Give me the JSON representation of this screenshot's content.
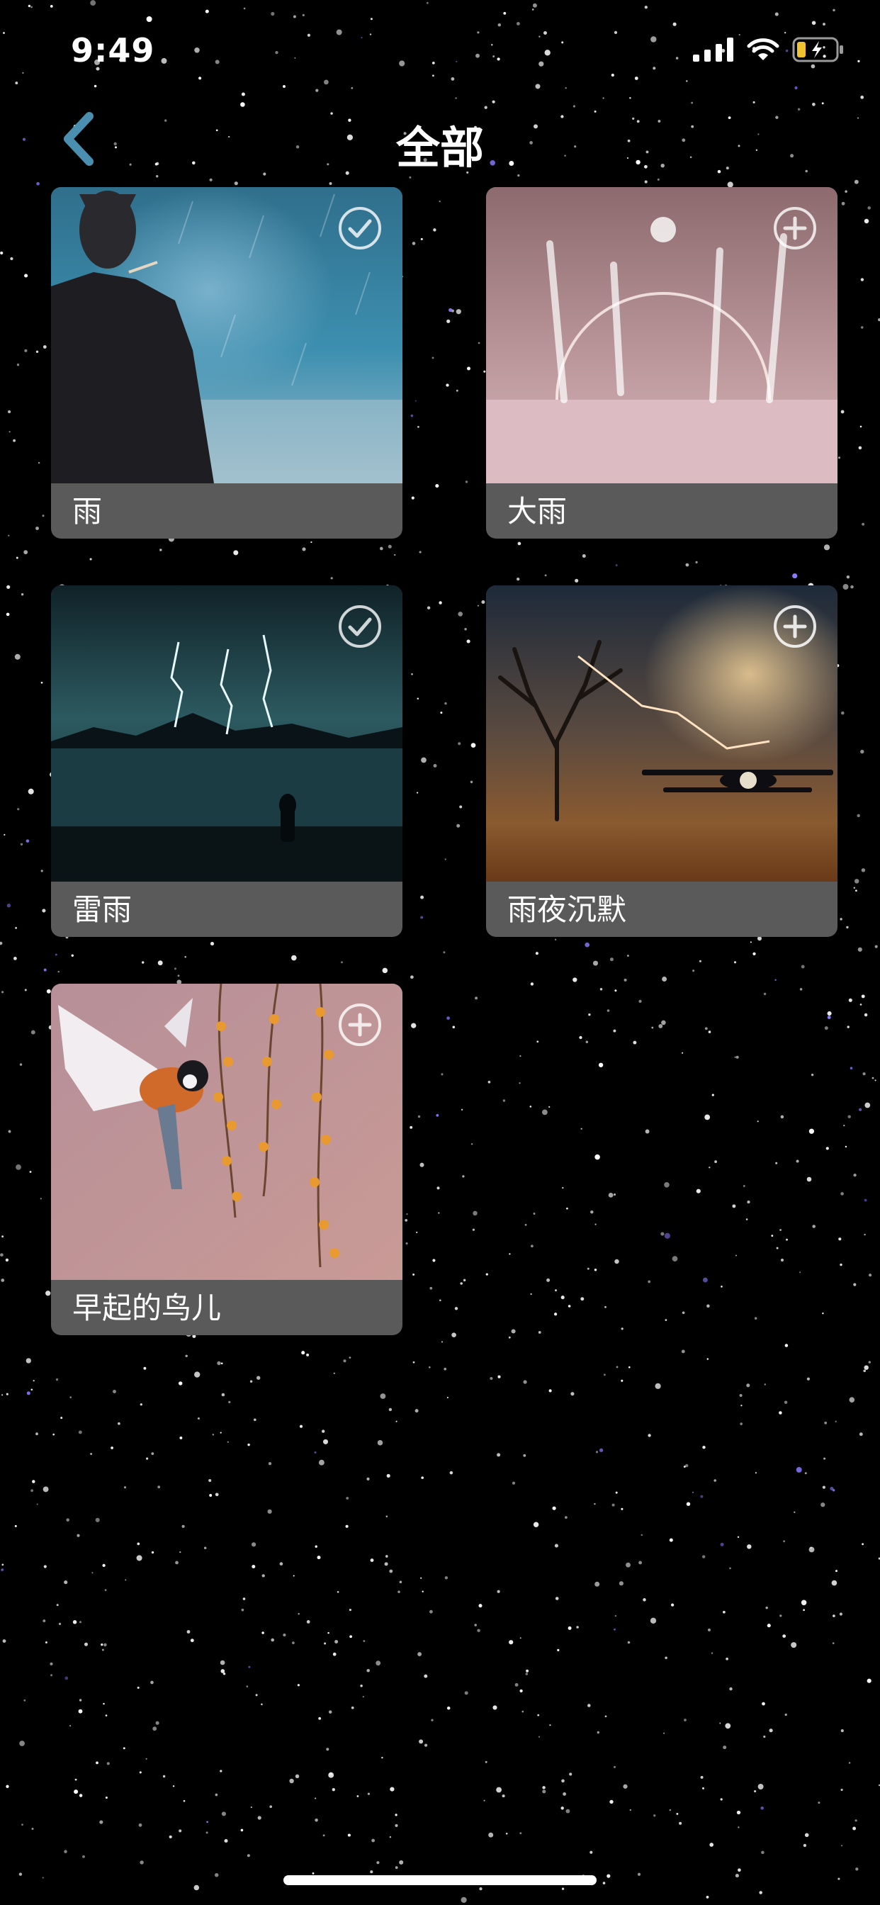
{
  "status_bar": {
    "time": "9:49"
  },
  "nav": {
    "title": "全部"
  },
  "sounds": [
    {
      "label": "雨",
      "state": "added",
      "icon": "check-circle-icon"
    },
    {
      "label": "大雨",
      "state": "not-added",
      "icon": "plus-circle-icon"
    },
    {
      "label": "雷雨",
      "state": "added",
      "icon": "check-circle-icon"
    },
    {
      "label": "雨夜沉默",
      "state": "not-added",
      "icon": "plus-circle-icon"
    },
    {
      "label": "早起的鸟儿",
      "state": "not-added",
      "icon": "plus-circle-icon"
    }
  ],
  "colors": {
    "background": "#000000",
    "label_bar": "#5a5a5a",
    "back_arrow": "#4a8fb0"
  }
}
